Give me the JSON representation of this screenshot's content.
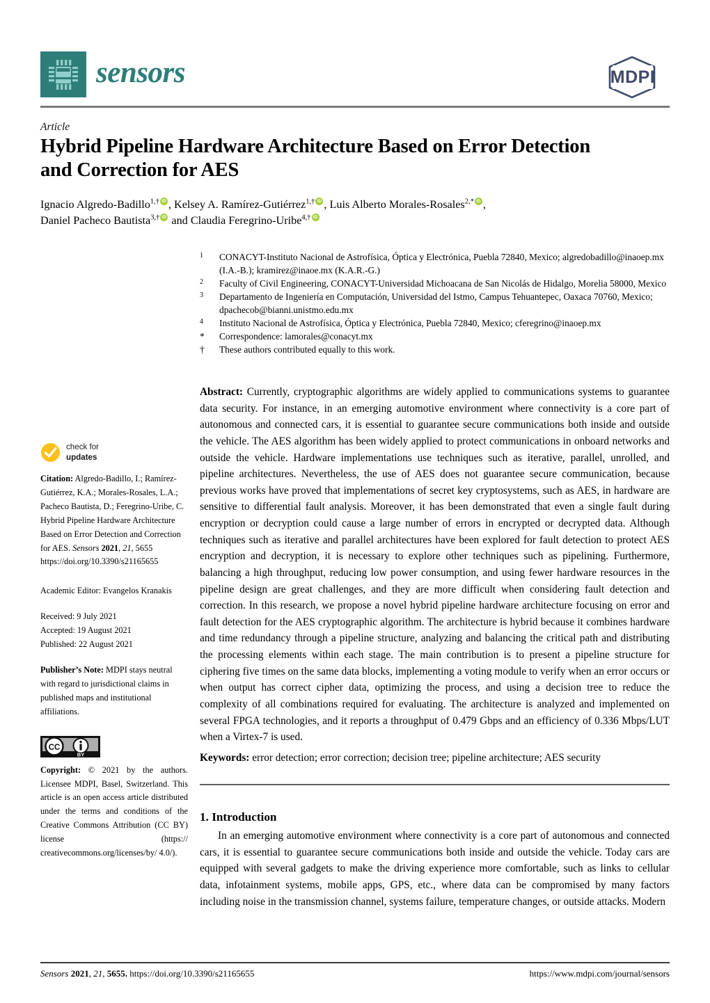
{
  "journal": {
    "name": "sensors",
    "logo_icon": "microchip-icon",
    "publisher_logo": "MDPI",
    "brand_color": "#2e7d79",
    "publisher_color": "#3f4a6b"
  },
  "article": {
    "type": "Article",
    "title": "Hybrid Pipeline Hardware Architecture Based on Error Detection and Correction for AES"
  },
  "authors": {
    "line1_parts": [
      {
        "name": "Ignacio Algredo-Badillo",
        "sup": "1,†",
        "orcid": true,
        "sep": ", "
      },
      {
        "name": "Kelsey A. Ramírez-Gutiérrez",
        "sup": "1,†",
        "orcid": true,
        "sep": ", "
      },
      {
        "name": "Luis Alberto Morales-Rosales",
        "sup": "2,*",
        "orcid": true,
        "sep": ","
      }
    ],
    "line2_parts": [
      {
        "name": "Daniel Pacheco Bautista",
        "sup": "3,†",
        "orcid": true,
        "sep": " and "
      },
      {
        "name": "Claudia Feregrino-Uribe",
        "sup": "4,†",
        "orcid": true,
        "sep": ""
      }
    ]
  },
  "affiliations": [
    {
      "marker": "1",
      "text": "CONACYT-Instituto Nacional de Astrofísica, Óptica y Electrónica, Puebla 72840, Mexico; algredobadillo@inaoep.mx (I.A.-B.); kramirez@inaoe.mx (K.A.R.-G.)"
    },
    {
      "marker": "2",
      "text": "Faculty of Civil Engineering, CONACYT-Universidad Michoacana de San Nicolás de Hidalgo, Morelia 58000, Mexico"
    },
    {
      "marker": "3",
      "text": "Departamento de Ingeniería en Computación, Universidad del Istmo, Campus Tehuantepec, Oaxaca 70760, Mexico; dpachecob@bianni.unistmo.edu.mx"
    },
    {
      "marker": "4",
      "text": "Instituto Nacional de Astrofísica, Óptica y Electrónica, Puebla 72840, Mexico; cferegrino@inaoep.mx"
    },
    {
      "marker": "*",
      "text": "Correspondence: lamorales@conacyt.mx"
    },
    {
      "marker": "†",
      "text": "These authors contributed equally to this work."
    }
  ],
  "abstract": {
    "label": "Abstract:",
    "text": "Currently, cryptographic algorithms are widely applied to communications systems to guarantee data security. For instance, in an emerging automotive environment where connectivity is a core part of autonomous and connected cars, it is essential to guarantee secure communications both inside and outside the vehicle. The AES algorithm has been widely applied to protect communications in onboard networks and outside the vehicle. Hardware implementations use techniques such as iterative, parallel, unrolled, and pipeline architectures. Nevertheless, the use of AES does not guarantee secure communication, because previous works have proved that implementations of secret key cryptosystems, such as AES, in hardware are sensitive to differential fault analysis. Moreover, it has been demonstrated that even a single fault during encryption or decryption could cause a large number of errors in encrypted or decrypted data. Although techniques such as iterative and parallel architectures have been explored for fault detection to protect AES encryption and decryption, it is necessary to explore other techniques such as pipelining. Furthermore, balancing a high throughput, reducing low power consumption, and using fewer hardware resources in the pipeline design are great challenges, and they are more difficult when considering fault detection and correction. In this research, we propose a novel hybrid pipeline hardware architecture focusing on error and fault detection for the AES cryptographic algorithm. The architecture is hybrid because it combines hardware and time redundancy through a pipeline structure, analyzing and balancing the critical path and distributing the processing elements within each stage. The main contribution is to present a pipeline structure for ciphering five times on the same data blocks, implementing a voting module to verify when an error occurs or when output has correct cipher data, optimizing the process, and using a decision tree to reduce the complexity of all combinations required for evaluating. The architecture is analyzed and implemented on several FPGA technologies, and it reports a throughput of 0.479 Gbps and an efficiency of 0.336 Mbps/LUT when a Virtex-7 is used."
  },
  "keywords": {
    "label": "Keywords:",
    "text": "error detection; error correction; decision tree; pipeline architecture; AES security"
  },
  "introduction": {
    "heading": "1. Introduction",
    "body": "In an emerging automotive environment where connectivity is a core part of autonomous and connected cars, it is essential to guarantee secure communications both inside and outside the vehicle. Today cars are equipped with several gadgets to make the driving experience more comfortable, such as links to cellular data, infotainment systems, mobile apps, GPS, etc., where data can be compromised by many factors including noise in the transmission channel, systems failure, temperature changes, or outside attacks. Modern"
  },
  "sidebar": {
    "check_for_updates": {
      "line1": "check for",
      "line2": "updates",
      "icon": "check-circle-icon",
      "color": "#fbc01b"
    },
    "citation_label": "Citation:",
    "citation_authors": "Algredo-Badillo, I.; Ramírez-Gutiérrez, K.A.; Morales-Rosales, L.A.; Pacheco Bautista, D.; Feregrino-Uribe, C.",
    "citation_title": "Hybrid Pipeline Hardware Architecture Based on Error Detection and Correction for AES.",
    "citation_journal": "Sensors",
    "citation_year": "2021",
    "citation_volume": "21",
    "citation_pages": "5655",
    "citation_doi": "https://doi.org/10.3390/s21165655",
    "academic_editor": "Academic Editor: Evangelos Kranakis",
    "received": "Received: 9 July 2021",
    "accepted": "Accepted: 19 August 2021",
    "published": "Published: 22 August 2021",
    "publisher_note_label": "Publisher’s Note:",
    "publisher_note_text": "MDPI stays neutral with regard to jurisdictional claims in published maps and institutional affiliations.",
    "license_badge": "cc-by-icon",
    "copyright_label": "Copyright:",
    "copyright_text": "© 2021 by the authors. Licensee MDPI, Basel, Switzerland. This article is an open access article distributed under the terms and conditions of the Creative Commons Attribution (CC BY) license (https:// creativecommons.org/licenses/by/ 4.0/)."
  },
  "footer": {
    "left_journal": "Sensors",
    "left_year": "2021",
    "left_volume": "21",
    "left_pages": "5655.",
    "left_doi": "https://doi.org/10.3390/s21165655",
    "right_url": "https://www.mdpi.com/journal/sensors"
  }
}
